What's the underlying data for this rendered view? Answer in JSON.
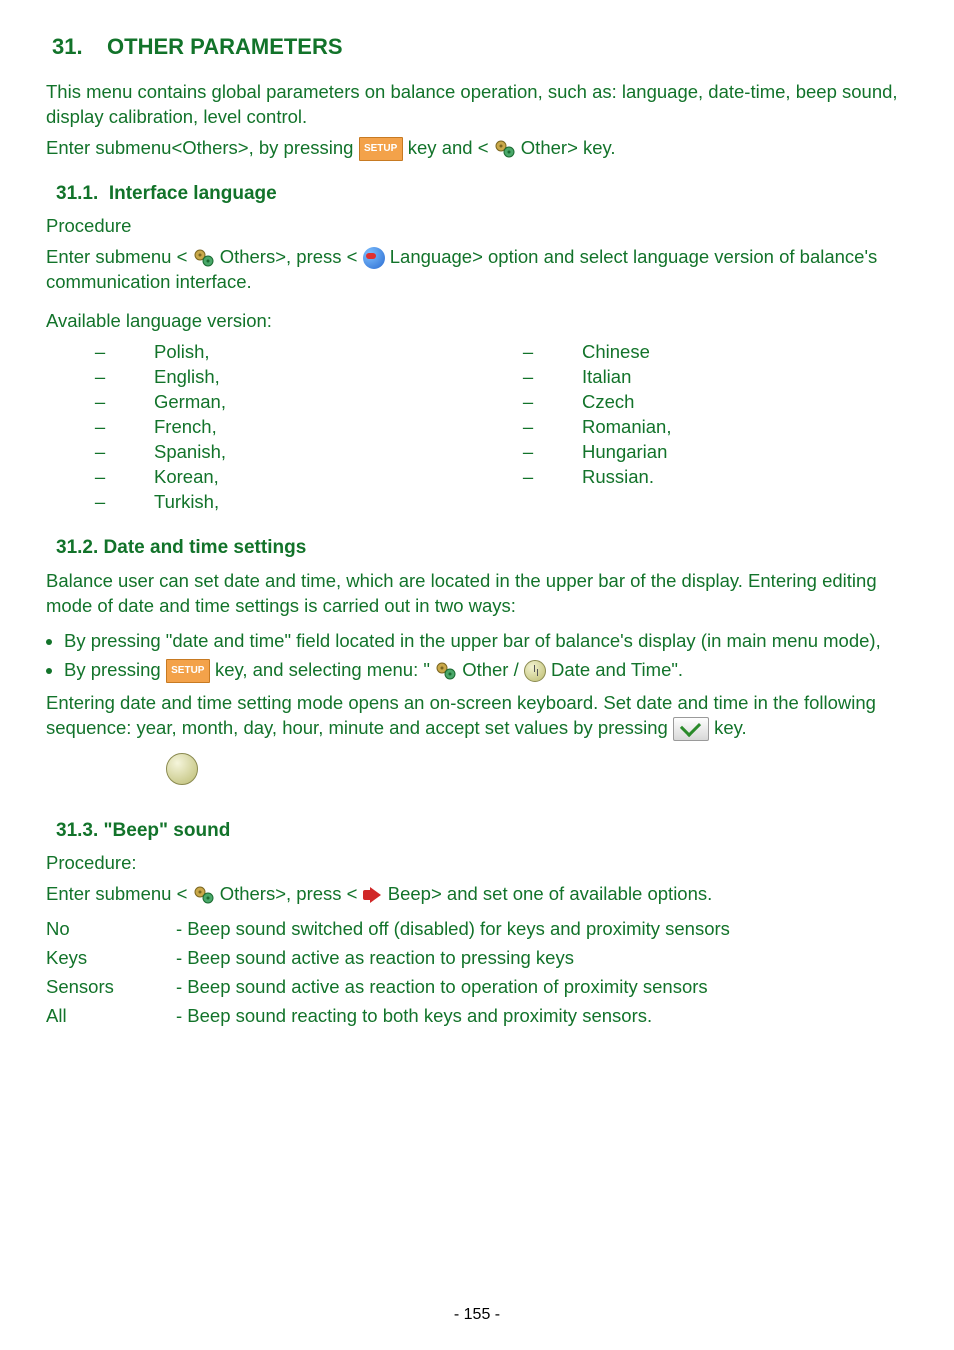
{
  "section": {
    "num": "31.",
    "title": "OTHER PARAMETERS"
  },
  "intro": {
    "p1_a": "This menu contains global parameters on balance operation, such as: language, date-time, beep sound, display calibration, level control.",
    "p2_a": "Enter submenu<Others>, by pressing ",
    "p2_b": " key and <",
    "p2_c": " Other> key."
  },
  "setup_label": "SETUP",
  "sub1": {
    "num": "31.1.",
    "title": "Interface language",
    "procedure_label": "Procedure",
    "p1_a": "Enter submenu <",
    "p1_b": " Others>, press < ",
    "p1_c": " Language> option and select language version of balance's communication interface.",
    "avail_label": "Available language version:",
    "left": [
      "Polish,",
      "English,",
      "German,",
      "French,",
      "Spanish,",
      "Korean,",
      "Turkish,"
    ],
    "right": [
      "Chinese",
      "Italian",
      "Czech",
      "Romanian,",
      "Hungarian",
      "Russian."
    ]
  },
  "sub2": {
    "num": "31.2.",
    "title": "Date and time settings",
    "p1": "Balance user can set date and time, which are located in the upper bar of the display. Entering editing mode of date and time settings is carried out in two ways:",
    "b1": "By pressing \"date and time\" field located in the upper bar of balance's display (in main menu mode),",
    "b2_a": "By pressing ",
    "b2_b": " key, and selecting menu: \"",
    "b2_c": " Other / ",
    "b2_d": " Date and Time\".",
    "p3_a": "Entering date and time setting mode opens an on-screen keyboard. Set date and time in the following sequence: year, month, day, hour, minute and accept set values by pressing ",
    "p3_b": " key."
  },
  "sub3": {
    "num": "31.3.",
    "title": "\"Beep\" sound",
    "procedure_label": "Procedure:",
    "p1_a": "Enter submenu <",
    "p1_b": " Others>, press < ",
    "p1_c": "Beep> and set one of available options.",
    "rows": [
      {
        "k": "No",
        "v": "-  Beep sound switched off (disabled) for keys and proximity sensors"
      },
      {
        "k": "Keys",
        "v": "-  Beep sound active as reaction to pressing keys"
      },
      {
        "k": "Sensors",
        "v": "-  Beep sound active as reaction to operation of proximity sensors"
      },
      {
        "k": "All",
        "v": "-  Beep sound reacting to both keys and proximity sensors."
      }
    ]
  },
  "page_number": "- 155 -"
}
